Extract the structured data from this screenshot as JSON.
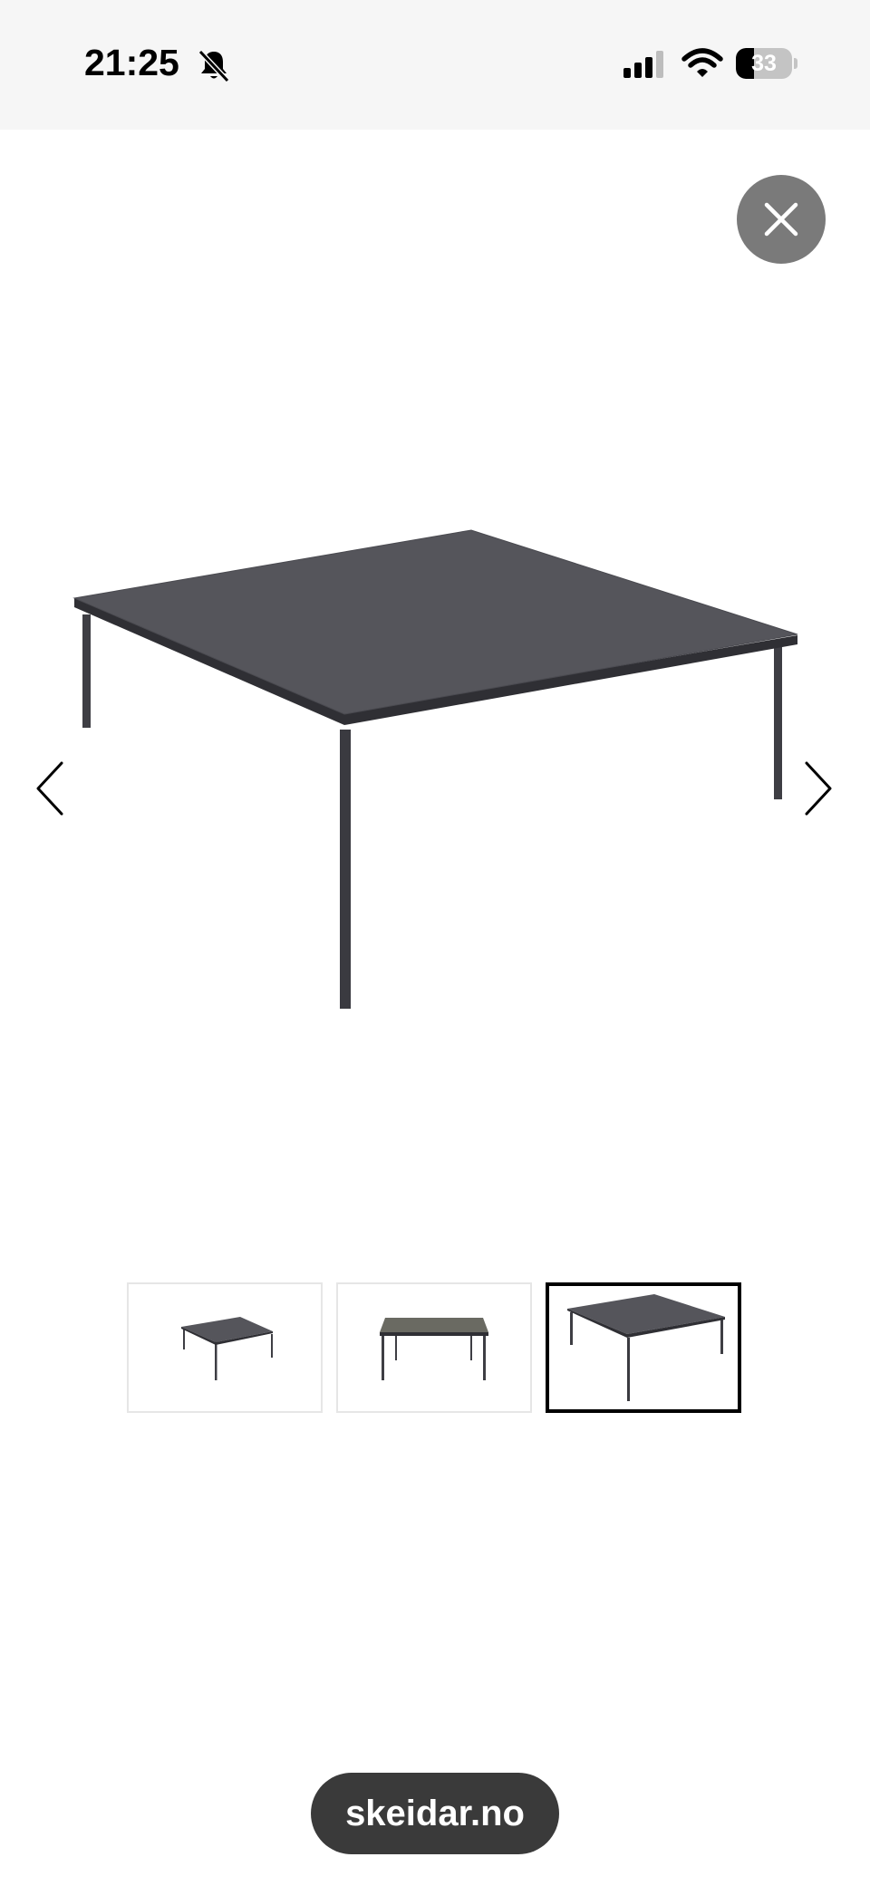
{
  "status_bar": {
    "time": "21:25",
    "battery": "33",
    "battery_level": 0.33,
    "icons": [
      "bell-slash-icon",
      "cellular-signal-icon",
      "wifi-icon",
      "battery-icon"
    ]
  },
  "gallery": {
    "close_icon": "close-icon",
    "prev_icon": "chevron-left-icon",
    "next_icon": "chevron-right-icon",
    "thumbnail_count": 3,
    "selected_thumbnail": 3
  },
  "browser": {
    "url": "skeidar.no"
  },
  "colors": {
    "table_top": "#55555b",
    "table_frame": "#3e3e44",
    "close_button": "#7a7a7a",
    "url_pill": "#3a3a3a",
    "status_bar_bg": "#f6f6f6"
  }
}
